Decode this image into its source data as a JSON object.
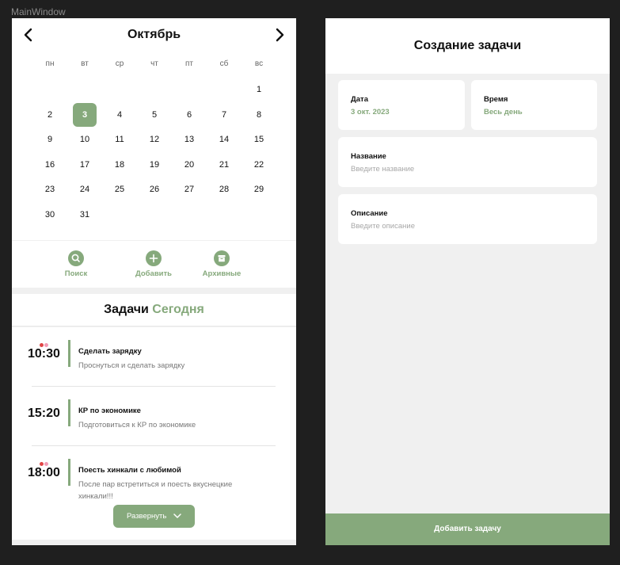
{
  "window": {
    "title": "MainWindow"
  },
  "calendar": {
    "month": "Октябрь",
    "weekdays": [
      "пн",
      "вт",
      "ср",
      "чт",
      "пт",
      "сб",
      "вс"
    ],
    "days": [
      "",
      "",
      "",
      "",
      "",
      "",
      "1",
      "2",
      "3",
      "4",
      "5",
      "6",
      "7",
      "8",
      "9",
      "10",
      "11",
      "12",
      "13",
      "14",
      "15",
      "16",
      "17",
      "18",
      "19",
      "20",
      "21",
      "22",
      "23",
      "24",
      "25",
      "26",
      "27",
      "28",
      "29",
      "30",
      "31",
      "",
      "",
      "",
      "",
      ""
    ],
    "selected_day": "3"
  },
  "actions": {
    "search_label": "Поиск",
    "add_label": "Добавить",
    "archive_label": "Архивные"
  },
  "tasks": {
    "heading": "Задачи",
    "heading_accent": "Сегодня",
    "items": [
      {
        "time": "10:30",
        "title": "Сделать зарядку",
        "description": "Проснуться и сделать зарядку",
        "dots": [
          "#e04545",
          "#f29ab5"
        ]
      },
      {
        "time": "15:20",
        "title": "КР по экономике",
        "description": "Подготовиться к КР по экономике",
        "dots": []
      },
      {
        "time": "18:00",
        "title": "Поесть хинкали с любимой",
        "description": "После пар встретиться и поесть вкуснецкие хинкали!!!",
        "dots": [
          "#e04545",
          "#f29ab5"
        ]
      }
    ],
    "expand_label": "Развернуть"
  },
  "create": {
    "title": "Создание задачи",
    "date_label": "Дата",
    "date_value": "3 окт. 2023",
    "time_label": "Время",
    "time_value": "Весь день",
    "name_label": "Название",
    "name_placeholder": "Введите название",
    "desc_label": "Описание",
    "desc_placeholder": "Введите описание",
    "submit_label": "Добавить задачу"
  },
  "colors": {
    "accent": "#86a97c",
    "background": "#1f1f1f",
    "panel": "#f0f0f0"
  }
}
